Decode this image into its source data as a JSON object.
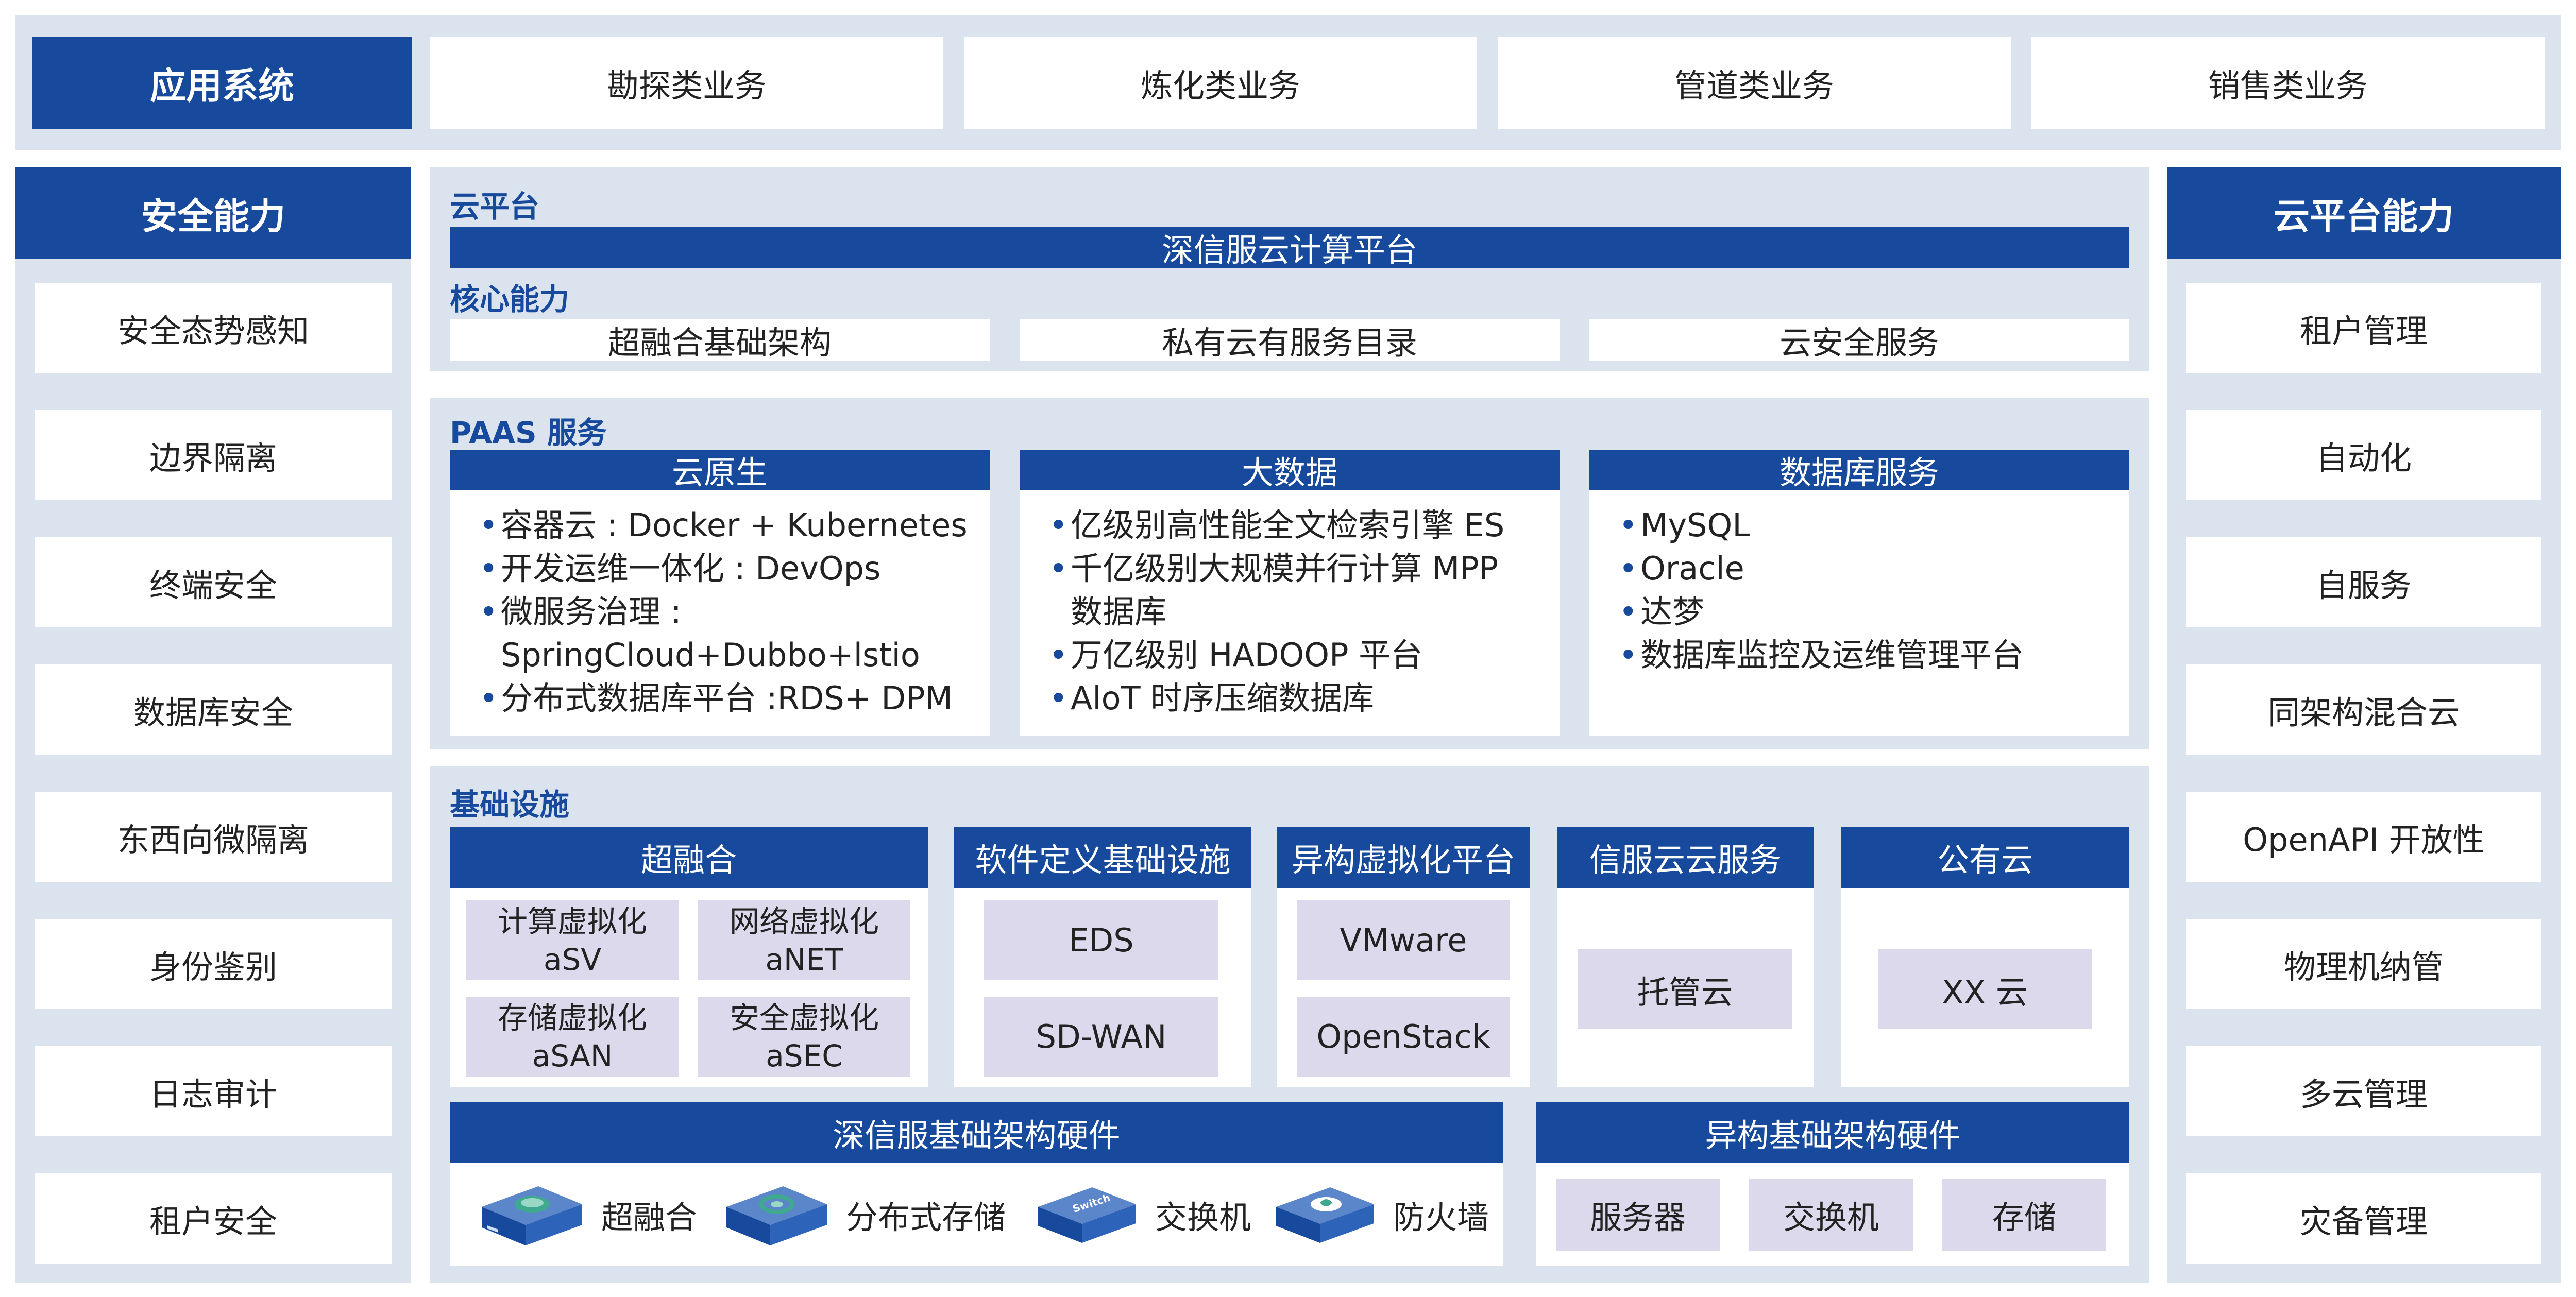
{
  "app_system": {
    "title": "应用系统",
    "items": [
      "勘探类业务",
      "炼化类业务",
      "管道类业务",
      "销售类业务"
    ]
  },
  "security": {
    "title": "安全能力",
    "items": [
      "安全态势感知",
      "边界隔离",
      "终端安全",
      "数据库安全",
      "东西向微隔离",
      "身份鉴别",
      "日志审计",
      "租户安全"
    ]
  },
  "cloud_capability": {
    "title": "云平台能力",
    "items": [
      "租户管理",
      "自动化",
      "自服务",
      "同架构混合云",
      "OpenAPI 开放性",
      "物理机纳管",
      "多云管理",
      "灾备管理"
    ]
  },
  "cloud_platform": {
    "title": "云平台",
    "bar": "深信服云计算平台",
    "core_title": "核心能力",
    "core_items": [
      "超融合基础架构",
      "私有云有服务目录",
      "云安全服务"
    ]
  },
  "paas": {
    "title": "PAAS 服务",
    "columns": [
      {
        "title": "云原生",
        "items": [
          "容器云 : Docker + Kubernetes",
          "开发运维一体化 : DevOps",
          "微服务治理 :",
          "SpringCloud+Dubbo+lstio",
          "分布式数据库平台 :RDS+ DPM"
        ]
      },
      {
        "title": "大数据",
        "items": [
          "亿级别高性能全文检索引擎 ES",
          "千亿级别大规模并行计算 MPP",
          "数据库",
          "万亿级别 HADOOP 平台",
          "AloT 时序压缩数据库"
        ]
      },
      {
        "title": "数据库服务",
        "items": [
          "MySQL",
          "Oracle",
          "达梦",
          "数据库监控及运维管理平台"
        ]
      }
    ]
  },
  "infra": {
    "title": "基础设施",
    "hci": {
      "title": "超融合",
      "tiles": [
        {
          "line1": "计算虚拟化",
          "line2": "aSV"
        },
        {
          "line1": "网络虚拟化",
          "line2": "aNET"
        },
        {
          "line1": "存储虚拟化",
          "line2": "aSAN"
        },
        {
          "line1": "安全虚拟化",
          "line2": "aSEC"
        }
      ]
    },
    "sdi": {
      "title": "软件定义基础设施",
      "items": [
        "EDS",
        "SD-WAN"
      ]
    },
    "hetero_virt": {
      "title": "异构虚拟化平台",
      "items": [
        "VMware",
        "OpenStack"
      ]
    },
    "sangfor_cloud": {
      "title": "信服云云服务",
      "item": "托管云"
    },
    "public_cloud": {
      "title": "公有云",
      "item": "XX 云"
    },
    "sangfor_hw": {
      "title": "深信服基础架构硬件",
      "items": [
        {
          "label": "超融合",
          "icon": "hci-appliance-icon"
        },
        {
          "label": "分布式存储",
          "icon": "storage-appliance-icon"
        },
        {
          "label": "交换机",
          "icon": "switch-appliance-icon"
        },
        {
          "label": "防火墙",
          "icon": "firewall-appliance-icon"
        }
      ],
      "device_text": {
        "switch": "Switch"
      }
    },
    "hetero_hw": {
      "title": "异构基础架构硬件",
      "items": [
        "服务器",
        "交换机",
        "存储"
      ]
    }
  },
  "colors": {
    "navy": "#174a9c",
    "pale": "#dbe3ef",
    "lavender": "#dcd9ec",
    "white": "#ffffff"
  }
}
